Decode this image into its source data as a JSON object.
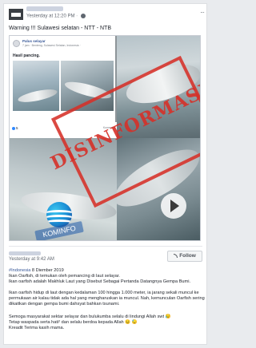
{
  "post": {
    "timestamp": "Yesterday at 12:20 PM ·",
    "title": "Warning !!! Sulawesi selatan - NTT - NTB",
    "more_label": "···"
  },
  "shared_screenshot": {
    "poster_name": "Palus selayar",
    "meta": "7 jam · Benteng, Sulawesi Selatan, Indonesia ·",
    "caption": "Hasil pancing.",
    "like_count": "5",
    "like_right": "Komentar",
    "stamp_text": "DISINFORMASI",
    "logo_text": "KOMINFO"
  },
  "post2": {
    "timestamp": "Yesterday at 9:42 AM",
    "follow_label": "Follow",
    "hashtag": "#Indonesia",
    "line1_rest": " 8 Diember 2019",
    "line2": "Ikan Oarfish, di temukan oleh pemancing di laut selayar.",
    "line3": "Ikan oarfish adalah Makhluk Laut yang Disebut Sebagai Pertanda Datangnya Gempa Bumi.",
    "line4": "Ikan oarfish hidup di laut dengan kedalaman 100 hingga 1.000 meter, ia jarang sekali muncul ke permukaan air kalau tidak ada hal yang mengharuskan ia muncul. Nah, kemunculan Oarfish sering dikaitkan dengan gempa bumi dahsyat bahkan tsunami.",
    "line5": "Semoga masyarakat sektar selayar dan bulukumba selalu di lindungi Allah swt 😥",
    "line6": "Tetap waspada serta hati² dan selalu berdoa kepada Allah 😣 😓",
    "line7": "Kreadit Terima kasih mama."
  },
  "icons": {
    "globe": "globe-icon",
    "more": "more-options-icon",
    "play": "play-icon",
    "rss": "rss-icon"
  },
  "colors": {
    "stamp_red": "#d63028",
    "link_blue": "#385898",
    "kominfo_blue": "#1b8fd6"
  }
}
